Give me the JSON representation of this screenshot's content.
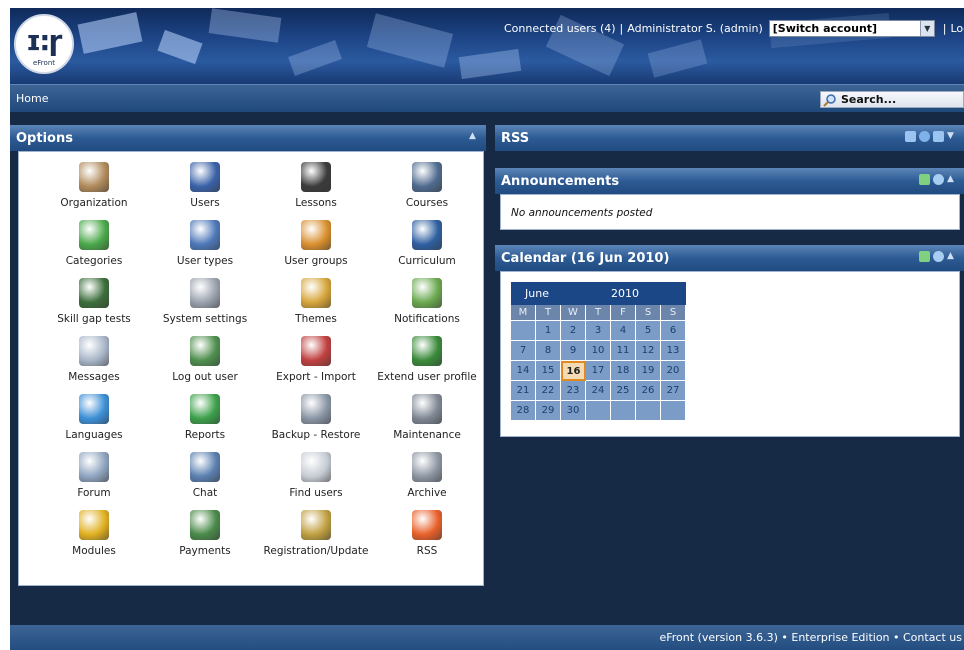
{
  "header": {
    "logo_text": "eFront",
    "connected_label": "Connected users (4)",
    "user_label": "Administrator S. (admin)",
    "switch_account": "[Switch account]",
    "logout": "Logout"
  },
  "nav": {
    "home": "Home",
    "search_placeholder": "Search..."
  },
  "options": {
    "title": "Options",
    "items": [
      {
        "label": "Organization",
        "icon": "organization-icon",
        "color": "#b08a5a"
      },
      {
        "label": "Users",
        "icon": "user-icon",
        "color": "#3a62a8"
      },
      {
        "label": "Lessons",
        "icon": "blackboard-icon",
        "color": "#3b3b3b"
      },
      {
        "label": "Courses",
        "icon": "courses-icon",
        "color": "#4f6b8f"
      },
      {
        "label": "Categories",
        "icon": "categories-icon",
        "color": "#4aa84a"
      },
      {
        "label": "User types",
        "icon": "user-types-icon",
        "color": "#4d78b8"
      },
      {
        "label": "User groups",
        "icon": "user-groups-icon",
        "color": "#d98f2e"
      },
      {
        "label": "Curriculum",
        "icon": "curriculum-icon",
        "color": "#2e5fa0"
      },
      {
        "label": "Skill gap tests",
        "icon": "skill-test-icon",
        "color": "#3c6e3c"
      },
      {
        "label": "System settings",
        "icon": "wrench-icon",
        "color": "#9aa2ad"
      },
      {
        "label": "Themes",
        "icon": "palette-icon",
        "color": "#d6a53a"
      },
      {
        "label": "Notifications",
        "icon": "notification-icon",
        "color": "#6aa84f"
      },
      {
        "label": "Messages",
        "icon": "envelope-icon",
        "color": "#a8b6c8"
      },
      {
        "label": "Log out user",
        "icon": "logout-user-icon",
        "color": "#4f8f4f"
      },
      {
        "label": "Export - Import",
        "icon": "export-import-icon",
        "color": "#c04040"
      },
      {
        "label": "Extend user profile",
        "icon": "extend-profile-icon",
        "color": "#3a8a3a"
      },
      {
        "label": "Languages",
        "icon": "globe-icon",
        "color": "#3c8fd6"
      },
      {
        "label": "Reports",
        "icon": "reports-icon",
        "color": "#3ca04a"
      },
      {
        "label": "Backup - Restore",
        "icon": "backup-icon",
        "color": "#8a96a6"
      },
      {
        "label": "Maintenance",
        "icon": "maintenance-icon",
        "color": "#7f8894"
      },
      {
        "label": "Forum",
        "icon": "forum-icon",
        "color": "#8ea4bf"
      },
      {
        "label": "Chat",
        "icon": "chat-icon",
        "color": "#5a80b0"
      },
      {
        "label": "Find users",
        "icon": "magnifier-icon",
        "color": "#c6ccd4"
      },
      {
        "label": "Archive",
        "icon": "gear-icon",
        "color": "#8d96a3"
      },
      {
        "label": "Modules",
        "icon": "puzzle-icon",
        "color": "#e0b020"
      },
      {
        "label": "Payments",
        "icon": "cart-icon",
        "color": "#4a8a4a"
      },
      {
        "label": "Registration/Update",
        "icon": "key-icon",
        "color": "#c0a040"
      },
      {
        "label": "RSS",
        "icon": "rss-icon",
        "color": "#e8602a"
      }
    ]
  },
  "rss": {
    "title": "RSS"
  },
  "announcements": {
    "title": "Announcements",
    "empty": "No announcements posted"
  },
  "calendar": {
    "title": "Calendar (16 Jun 2010)",
    "month": "June",
    "year": "2010",
    "day_headers": [
      "M",
      "T",
      "W",
      "T",
      "F",
      "S",
      "S"
    ],
    "days": [
      "",
      "1",
      "2",
      "3",
      "4",
      "5",
      "6",
      "7",
      "8",
      "9",
      "10",
      "11",
      "12",
      "13",
      "14",
      "15",
      "16",
      "17",
      "18",
      "19",
      "20",
      "21",
      "22",
      "23",
      "24",
      "25",
      "26",
      "27",
      "28",
      "29",
      "30",
      "",
      "",
      "",
      ""
    ],
    "today": "16"
  },
  "footer": {
    "text": "eFront (version 3.6.3) • Enterprise Edition • Contact us"
  }
}
